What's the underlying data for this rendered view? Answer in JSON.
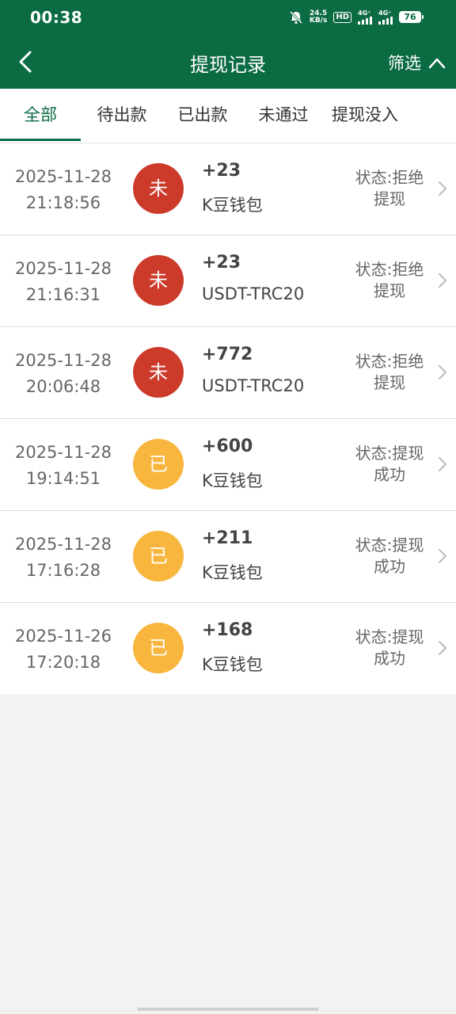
{
  "statusbar": {
    "time": "00:38",
    "speed_value": "24.5",
    "speed_unit": "KB/s",
    "hd_label": "HD",
    "sim1_label": "4G⁺",
    "sim2_label": "4G⁺",
    "battery": "76"
  },
  "header": {
    "title": "提现记录",
    "filter_label": "筛选"
  },
  "tabs": [
    {
      "label": "全部",
      "active": true
    },
    {
      "label": "待出款",
      "active": false
    },
    {
      "label": "已出款",
      "active": false
    },
    {
      "label": "未通过",
      "active": false
    },
    {
      "label": "提现没入",
      "active": false
    }
  ],
  "records": [
    {
      "date": "2025-11-28",
      "time": "21:18:56",
      "badge": "未",
      "badge_color": "#cc3a2a",
      "amount": "+23",
      "method": "K豆钱包",
      "status_line1": "状态:拒绝",
      "status_line2": "提现"
    },
    {
      "date": "2025-11-28",
      "time": "21:16:31",
      "badge": "未",
      "badge_color": "#cc3a2a",
      "amount": "+23",
      "method": "USDT-TRC20",
      "status_line1": "状态:拒绝",
      "status_line2": "提现"
    },
    {
      "date": "2025-11-28",
      "time": "20:06:48",
      "badge": "未",
      "badge_color": "#cc3a2a",
      "amount": "+772",
      "method": "USDT-TRC20",
      "status_line1": "状态:拒绝",
      "status_line2": "提现"
    },
    {
      "date": "2025-11-28",
      "time": "19:14:51",
      "badge": "已",
      "badge_color": "#f8b63e",
      "amount": "+600",
      "method": "K豆钱包",
      "status_line1": "状态:提现",
      "status_line2": "成功"
    },
    {
      "date": "2025-11-28",
      "time": "17:16:28",
      "badge": "已",
      "badge_color": "#f8b63e",
      "amount": "+211",
      "method": "K豆钱包",
      "status_line1": "状态:提现",
      "status_line2": "成功"
    },
    {
      "date": "2025-11-26",
      "time": "17:20:18",
      "badge": "已",
      "badge_color": "#f8b63e",
      "amount": "+168",
      "method": "K豆钱包",
      "status_line1": "状态:提现",
      "status_line2": "成功"
    }
  ],
  "colors": {
    "brand": "#0b6b43",
    "rejected": "#cc3a2a",
    "approved": "#f8b63e",
    "background": "#f2f2f2"
  },
  "icons": [
    "mute-icon",
    "back-chevron-icon",
    "chevron-up-icon",
    "chevron-right-icon"
  ]
}
